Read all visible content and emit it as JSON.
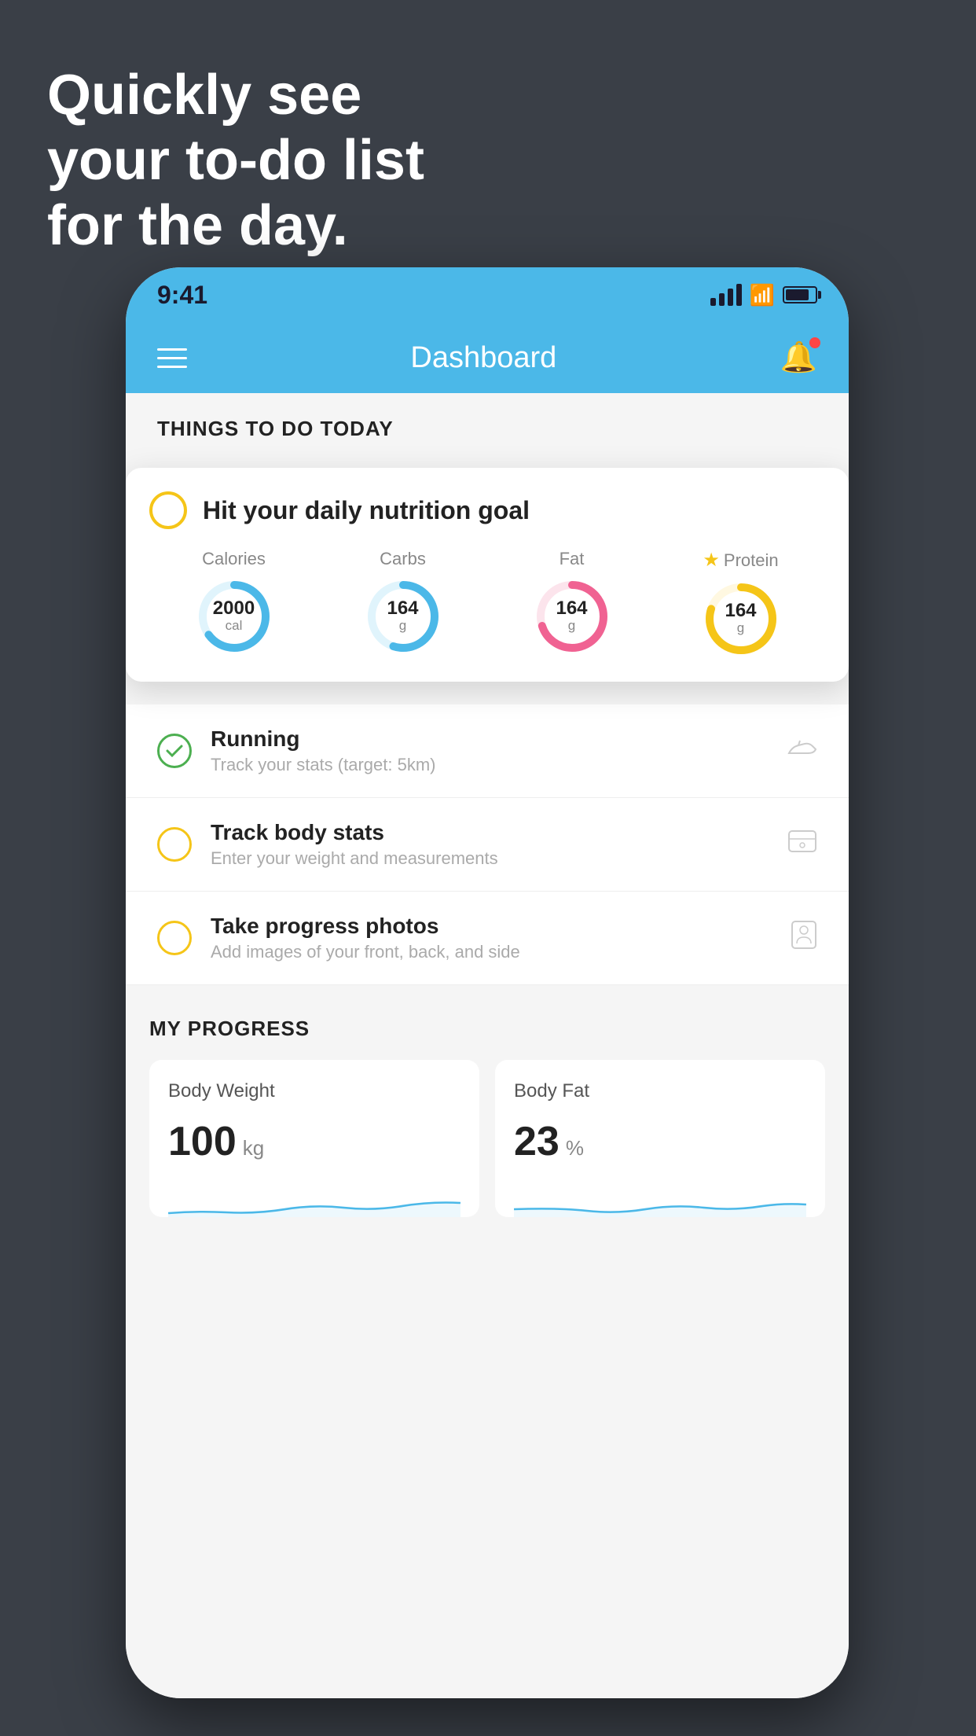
{
  "headline": {
    "line1": "Quickly see",
    "line2": "your to-do list",
    "line3": "for the day."
  },
  "status_bar": {
    "time": "9:41"
  },
  "app_header": {
    "title": "Dashboard"
  },
  "things_today": {
    "section_title": "THINGS TO DO TODAY"
  },
  "nutrition_card": {
    "title": "Hit your daily nutrition goal",
    "circles": [
      {
        "label": "Calories",
        "value": "2000",
        "unit": "cal",
        "color": "#4bb8e8",
        "track_color": "#e0f4fc",
        "percent": 65,
        "starred": false
      },
      {
        "label": "Carbs",
        "value": "164",
        "unit": "g",
        "color": "#4bb8e8",
        "track_color": "#e0f4fc",
        "percent": 55,
        "starred": false
      },
      {
        "label": "Fat",
        "value": "164",
        "unit": "g",
        "color": "#f06292",
        "track_color": "#fce4ec",
        "percent": 70,
        "starred": false
      },
      {
        "label": "Protein",
        "value": "164",
        "unit": "g",
        "color": "#f5c518",
        "track_color": "#fff8e1",
        "percent": 80,
        "starred": true
      }
    ]
  },
  "todo_items": [
    {
      "id": "running",
      "name": "Running",
      "desc": "Track your stats (target: 5km)",
      "circle_color": "green",
      "icon": "👟"
    },
    {
      "id": "body_stats",
      "name": "Track body stats",
      "desc": "Enter your weight and measurements",
      "circle_color": "yellow",
      "icon": "⚖"
    },
    {
      "id": "photos",
      "name": "Take progress photos",
      "desc": "Add images of your front, back, and side",
      "circle_color": "yellow",
      "icon": "👤"
    }
  ],
  "progress": {
    "section_title": "MY PROGRESS",
    "cards": [
      {
        "title": "Body Weight",
        "value": "100",
        "unit": "kg"
      },
      {
        "title": "Body Fat",
        "value": "23",
        "unit": "%"
      }
    ]
  }
}
